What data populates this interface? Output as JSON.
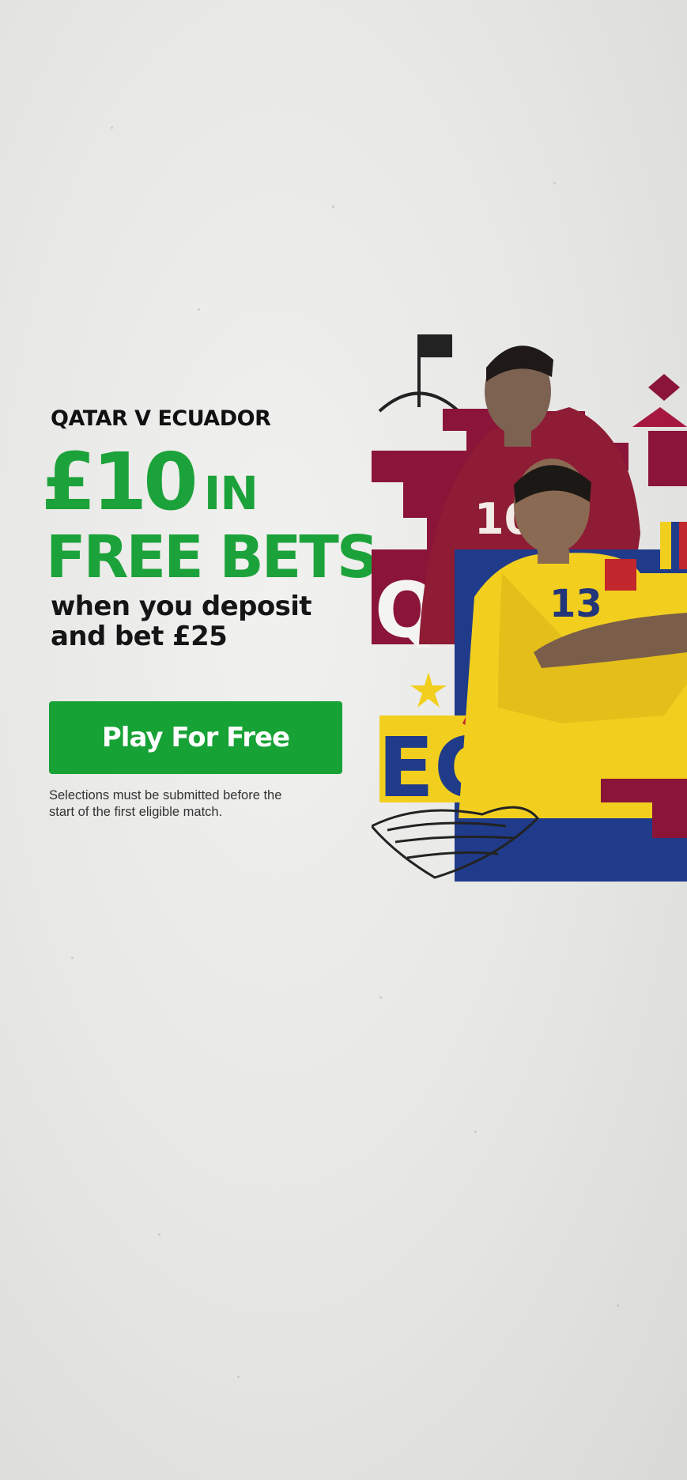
{
  "promo": {
    "match_title": "QATAR V ECUADOR",
    "headline_amount": "£10",
    "headline_in": "IN",
    "headline_free_bets": "FREE BETS",
    "subline_1": "when you deposit",
    "subline_2": "and bet £25",
    "cta_label": "Play For Free",
    "disclaimer": "Selections must be submitted before the start of the first eligible match."
  },
  "artwork": {
    "left_team_text": "QAT",
    "right_team_text": "ECU",
    "left_shirt_number": "10",
    "right_shirt_number": "13"
  },
  "colors": {
    "brand_green": "#17a235",
    "qatar_maroon": "#8a1538",
    "ecuador_yellow": "#f2cf1f",
    "ecuador_blue": "#1f3b8a"
  }
}
